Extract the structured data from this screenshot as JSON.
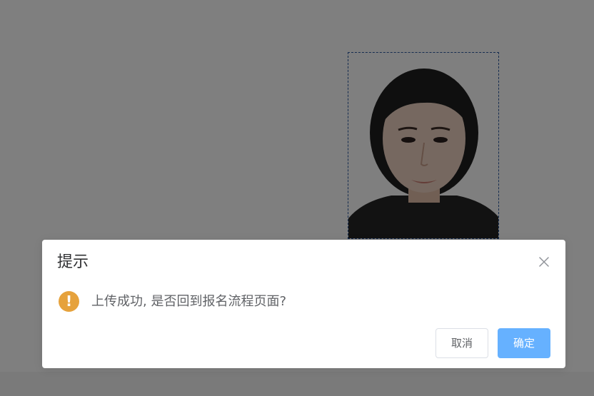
{
  "photo": {
    "description_icon": "id-photo"
  },
  "dialog": {
    "title": "提示",
    "message": "上传成功, 是否回到报名流程页面?",
    "warning_icon_glyph": "!",
    "cancel_label": "取消",
    "confirm_label": "确定"
  },
  "colors": {
    "warning": "#e6a23c",
    "primary_light": "#66b1ff",
    "overlay": "rgba(0,0,0,0.5)",
    "photo_border": "#2c5aa0"
  },
  "icons": {
    "close": "close-icon",
    "warning": "warning-icon"
  }
}
